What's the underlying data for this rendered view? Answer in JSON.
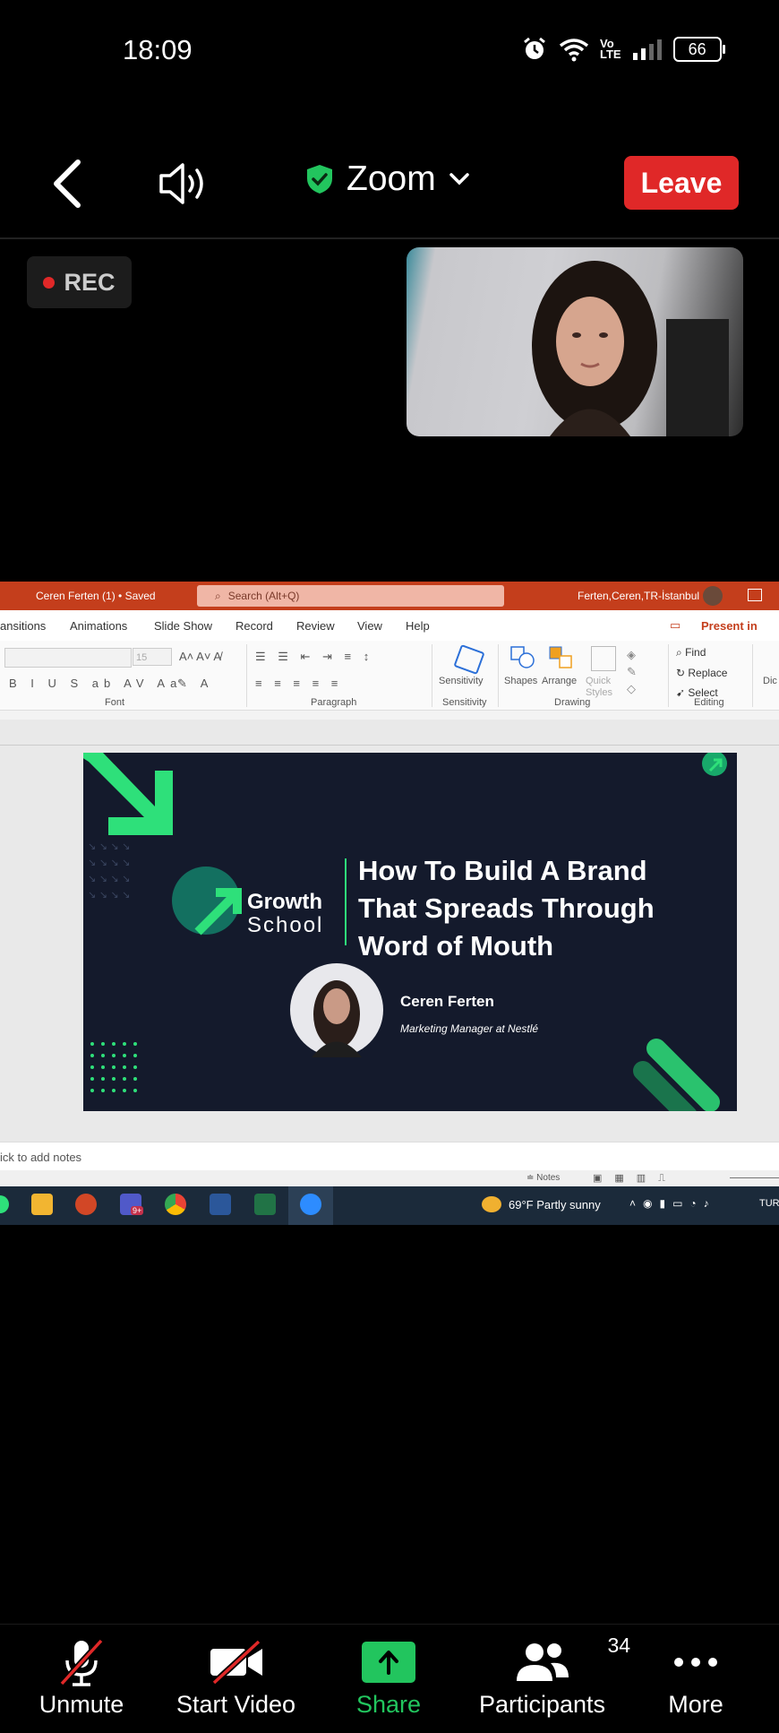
{
  "status_bar": {
    "time": "18:09",
    "battery": "66",
    "network": "LTE"
  },
  "topbar": {
    "title": "Zoom",
    "leave_label": "Leave"
  },
  "recording": {
    "label": "REC"
  },
  "shared_screen": {
    "powerpoint": {
      "doc_title": "Ceren Ferten (1) • Saved",
      "search_placeholder": "Search (Alt+Q)",
      "user": "Ferten,Ceren,TR-İstanbul",
      "tabs": [
        "ansitions",
        "Animations",
        "Slide Show",
        "Record",
        "Review",
        "View",
        "Help"
      ],
      "present_label": "Present in",
      "ribbon": {
        "font_size": "15",
        "groups": [
          "Font",
          "Paragraph",
          "Sensitivity",
          "Drawing",
          "Editing"
        ],
        "sensitivity_label": "Sensitivity",
        "shapes_label": "Shapes",
        "arrange_label": "Arrange",
        "quick_styles_label": "Quick Styles",
        "find_label": "Find",
        "replace_label": "Replace",
        "select_label": "Select",
        "dic_label": "Dic"
      },
      "slide": {
        "logo_line1": "Growth",
        "logo_line2": "School",
        "title_line1": "How To Build A Brand",
        "title_line2": "That Spreads Through",
        "title_line3": "Word of Mouth",
        "speaker_name": "Ceren Ferten",
        "speaker_role": "Marketing Manager at Nestlé"
      },
      "notes_placeholder": "ick to add notes",
      "notes_button": "Notes"
    },
    "taskbar": {
      "weather": "69°F  Partly sunny",
      "teams_badge": "9+",
      "clock_partial": "TUR"
    }
  },
  "toolbar": {
    "unmute_label": "Unmute",
    "start_video_label": "Start Video",
    "share_label": "Share",
    "participants_label": "Participants",
    "participants_count": "34",
    "more_label": "More"
  },
  "colors": {
    "leave": "#e02828",
    "share_green": "#22c55e",
    "powerpoint": "#c43e1c",
    "slide_green": "#2ee07a"
  }
}
